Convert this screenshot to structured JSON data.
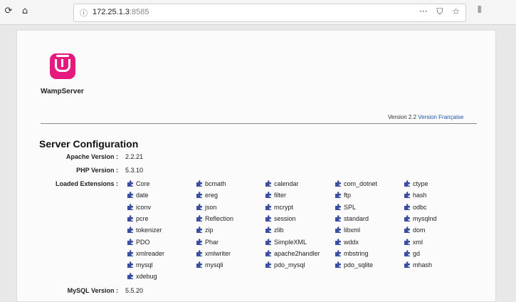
{
  "browser": {
    "url_host": "172.25.1.3",
    "url_port": ":8585",
    "reload_icon": "reload-icon",
    "home_icon": "home-icon"
  },
  "page": {
    "logo_text": "WampServer",
    "version_text": "Version 2.2",
    "version_link": "Version Française",
    "section_title": "Server Configuration",
    "apache_label": "Apache Version :",
    "apache_value": "2.2.21",
    "php_label": "PHP Version :",
    "php_value": "5.3.10",
    "extensions_label": "Loaded Extensions :",
    "mysql_label": "MySQL Version :",
    "mysql_value": "5.5.20",
    "extensions": [
      [
        "Core",
        "bcmath",
        "calendar",
        "com_dotnet",
        "ctype"
      ],
      [
        "date",
        "ereg",
        "filter",
        "ftp",
        "hash"
      ],
      [
        "iconv",
        "json",
        "mcrypt",
        "SPL",
        "odbc"
      ],
      [
        "pcre",
        "Reflection",
        "session",
        "standard",
        "mysqlnd"
      ],
      [
        "tokenizer",
        "zip",
        "zlib",
        "libxml",
        "dom"
      ],
      [
        "PDO",
        "Phar",
        "SimpleXML",
        "wddx",
        "xml"
      ],
      [
        "xmlreader",
        "xmlwriter",
        "apache2handler",
        "mbstring",
        "gd"
      ],
      [
        "mysql",
        "mysqli",
        "pdo_mysql",
        "pdo_sqlite",
        "mhash"
      ],
      [
        "xdebug"
      ]
    ]
  },
  "colors": {
    "brand": "#e6197f",
    "link": "#2255aa",
    "ext_icon": "#3a4fa0"
  }
}
